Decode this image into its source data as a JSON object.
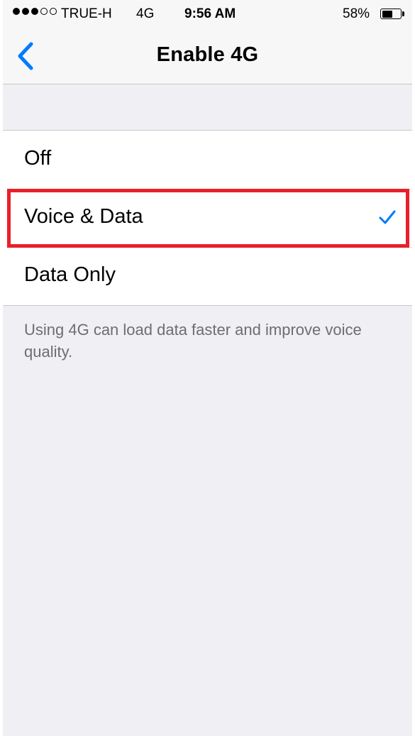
{
  "status_bar": {
    "signal_filled": 3,
    "signal_total": 5,
    "carrier": "TRUE-H",
    "network": "4G",
    "time": "9:56 AM",
    "battery_percent_label": "58%",
    "battery_level": 0.58
  },
  "nav": {
    "back_icon": "chevron-left-icon",
    "title": "Enable 4G"
  },
  "options": [
    {
      "label": "Off",
      "selected": false
    },
    {
      "label": "Voice & Data",
      "selected": true
    },
    {
      "label": "Data Only",
      "selected": false
    }
  ],
  "footer": {
    "note": "Using 4G can load data faster and improve voice quality."
  },
  "colors": {
    "accent": "#007aff",
    "highlight": "#e8202a",
    "background": "#efeff4",
    "secondary_text": "#6d6d72"
  }
}
